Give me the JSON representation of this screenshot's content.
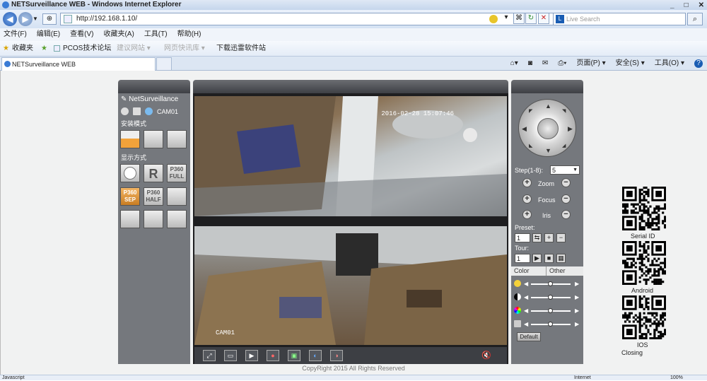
{
  "window": {
    "title": "NETSurveillance WEB - Windows Internet Explorer"
  },
  "address": {
    "url": "http://192.168.1.10/",
    "search_placeholder": "Live Search"
  },
  "menu": [
    "文件(F)",
    "编辑(E)",
    "查看(V)",
    "收藏夹(A)",
    "工具(T)",
    "帮助(H)"
  ],
  "favorites": {
    "label": "收藏夹",
    "items": [
      "PCOS技术论坛",
      "建议网站 ▾",
      "网页快讯库 ▾",
      "下载迅雷软件站"
    ]
  },
  "tab": {
    "title": "NETSurveillance WEB"
  },
  "commandbar": {
    "page": "页面(P) ▾",
    "safety": "安全(S) ▾",
    "tools": "工具(O) ▾",
    "help": "?"
  },
  "left_panel": {
    "brand": "NetSurveillance",
    "camera": "CAM01",
    "install_mode_label": "安装模式",
    "display_mode_label": "显示方式",
    "modes": {
      "r": "R",
      "p360_full": "P360 FULL",
      "p360_sep": "P360 SEP",
      "p360_half": "P360 HALF"
    }
  },
  "video": {
    "timestamp": "2016-02-28 15:07:46",
    "camera_label": "CAM01"
  },
  "right_panel": {
    "step_label": "Step(1-8):",
    "step_value": "5",
    "zoom": "Zoom",
    "focus": "Focus",
    "iris": "Iris",
    "preset_label": "Preset:",
    "preset_value": "1",
    "tour_label": "Tour:",
    "tour_value": "1",
    "color_tab": "Color",
    "other_tab": "Other",
    "default_button": "Default",
    "slider_levels": [
      0.5,
      0.5,
      0.5,
      0.5
    ]
  },
  "qr": {
    "serial": "Serial ID",
    "android": "Android",
    "ios": "IOS",
    "closing": "Closing"
  },
  "footer": {
    "copyright": "CopyRight 2015 All Rights Reserved"
  },
  "status": {
    "left": "Javascript",
    "zone": "Internet",
    "zoom": "100%"
  }
}
